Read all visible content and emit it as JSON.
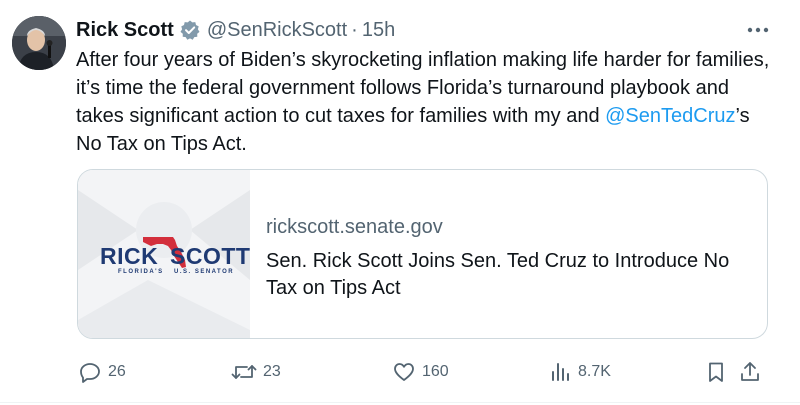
{
  "tweet": {
    "author_name": "Rick Scott",
    "handle": "@SenRickScott",
    "separator": "·",
    "time": "15h",
    "text_before": "After four years of Biden’s skyrocketing inflation making life harder for families, it’s time the federal government follows Florida’s turnaround playbook and takes significant action to cut taxes for families with my and ",
    "mention": "@SenTedCruz",
    "text_after": "’s No Tax on Tips Act."
  },
  "card": {
    "domain": "rickscott.senate.gov",
    "title": "Sen. Rick Scott Joins Sen. Ted Cruz to Introduce No Tax on Tips Act",
    "logo": {
      "left_word": "RICK",
      "right_word": "SCOTT",
      "sub_left": "FLORIDA'S",
      "sub_right": "U.S. SENATOR"
    }
  },
  "actions": {
    "replies": "26",
    "reposts": "23",
    "likes": "160",
    "views": "8.7K"
  },
  "icons": {
    "verified": "verified-badge-icon",
    "more": "more-dots-icon",
    "reply": "reply-icon",
    "repost": "repost-icon",
    "like": "heart-icon",
    "views": "views-chart-icon",
    "bookmark": "bookmark-icon",
    "share": "share-icon"
  },
  "colors": {
    "text": "#0f1419",
    "secondary": "#536471",
    "link": "#1d9bf0",
    "verified": "#829aab",
    "logo_blue": "#1f3a73",
    "logo_red": "#d32f3c"
  }
}
